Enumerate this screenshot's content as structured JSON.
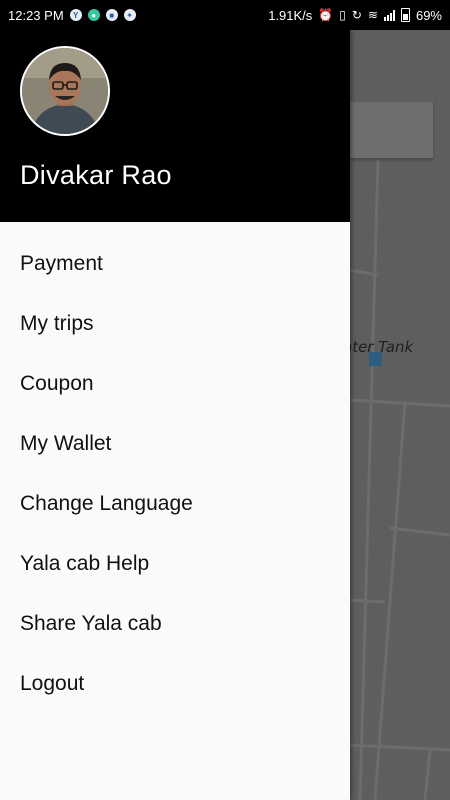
{
  "status_bar": {
    "time": "12:23 PM",
    "network_speed": "1.91K/s",
    "battery_percent": "69%",
    "notification_icons": [
      "yandex-icon",
      "green-app-icon",
      "messenger-icon",
      "assistant-icon"
    ],
    "system_icons": [
      "alarm-icon",
      "vibrate-icon",
      "sync-icon",
      "wifi-icon",
      "signal-icon",
      "battery-icon"
    ]
  },
  "drawer": {
    "user_name": "Divakar Rao",
    "menu_items": [
      {
        "label": "Payment"
      },
      {
        "label": "My trips"
      },
      {
        "label": "Coupon"
      },
      {
        "label": "My Wallet"
      },
      {
        "label": "Change Language"
      },
      {
        "label": "Yala cab Help"
      },
      {
        "label": "Share Yala cab"
      },
      {
        "label": "Logout"
      }
    ]
  },
  "map": {
    "place_label": "ater Tank"
  },
  "colors": {
    "header_bg": "#000000",
    "drawer_bg": "#fafafa",
    "map_bg": "#5e5e5e"
  }
}
